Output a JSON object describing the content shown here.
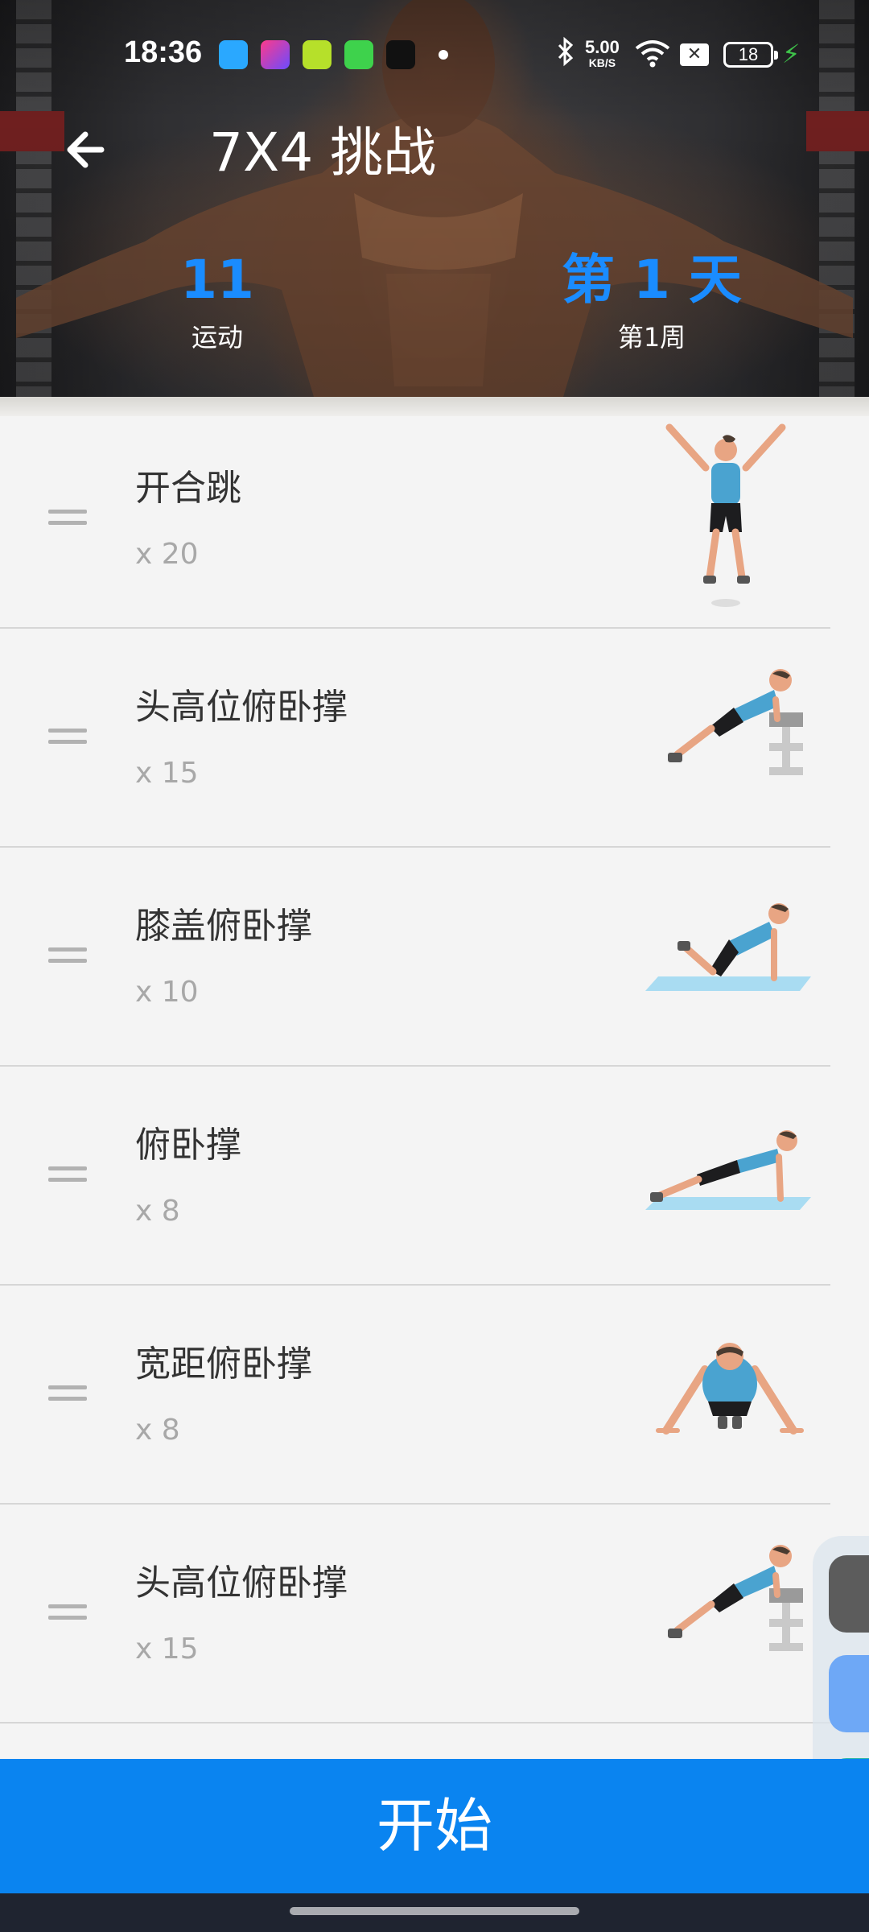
{
  "status_bar": {
    "time": "18:36",
    "network_speed": "5.00",
    "network_unit": "KB/S",
    "battery": "18"
  },
  "toolbar": {
    "title": "7X4 挑战"
  },
  "stats": {
    "exercises_count": "11",
    "exercises_label": "运动",
    "day_value": "第 1 天",
    "week_label": "第1周"
  },
  "exercises": [
    {
      "name": "开合跳",
      "reps": "x 20",
      "illustration": "jumping-jack-figure"
    },
    {
      "name": "头高位俯卧撑",
      "reps": "x 15",
      "illustration": "incline-pushup-figure"
    },
    {
      "name": "膝盖俯卧撑",
      "reps": "x 10",
      "illustration": "knee-pushup-figure"
    },
    {
      "name": "俯卧撑",
      "reps": "x 8",
      "illustration": "pushup-figure"
    },
    {
      "name": "宽距俯卧撑",
      "reps": "x 8",
      "illustration": "wide-pushup-figure"
    },
    {
      "name": "头高位俯卧撑",
      "reps": "x 15",
      "illustration": "incline-pushup-figure"
    }
  ],
  "start_button": {
    "label": "开始"
  },
  "colors": {
    "accent": "#0a84f0",
    "stat_blue": "#1a8cff",
    "row_divider": "#d6d6d6",
    "shirt": "#4aa3d0",
    "mat": "#a9dcf2"
  }
}
